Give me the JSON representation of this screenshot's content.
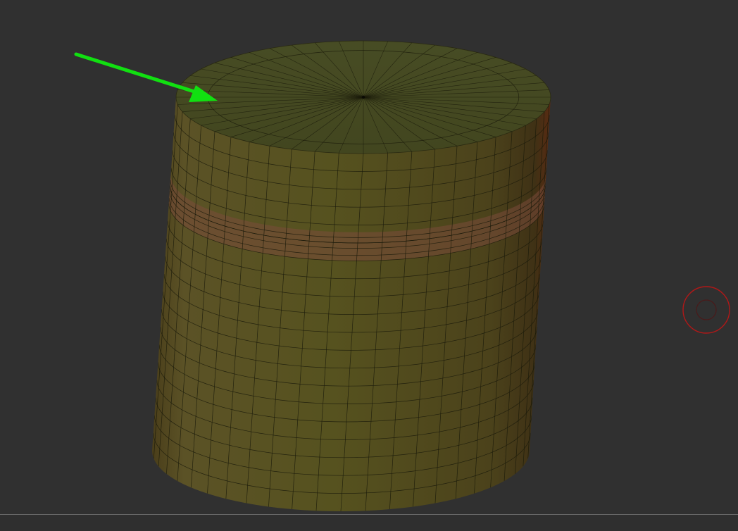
{
  "viewport": {
    "background_color": "#303030",
    "mesh": {
      "name": "cylinder",
      "base_color": "#4a4a22",
      "polygroup_band_color": "#7a4a3a",
      "wireframe_color": "#1a1a0a",
      "top_cap_radial_segments": 48,
      "side_segments": 20
    },
    "annotation": {
      "arrow_icon": "arrow-icon",
      "arrow_color": "#11e011"
    },
    "widget": {
      "icon": "transpose-circle-icon",
      "color": "#b01818"
    }
  },
  "bottom_bar": {
    "separator_color": "#6a6a6a"
  }
}
